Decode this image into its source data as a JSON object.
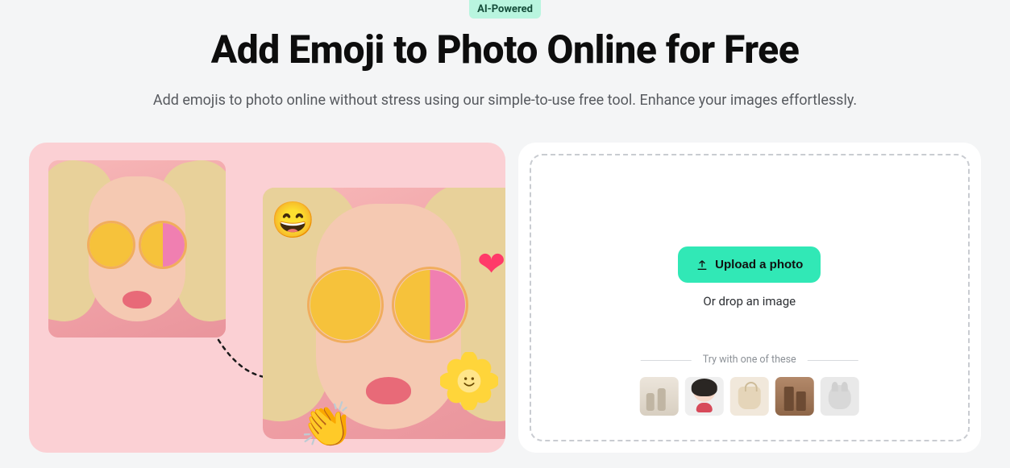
{
  "badge": "AI-Powered",
  "title": "Add Emoji to Photo Online for Free",
  "subtitle": "Add emojis to photo online without stress using our simple-to-use free tool. Enhance your images effortlessly.",
  "upload": {
    "button": "Upload a photo",
    "drop_text": "Or drop an image"
  },
  "samples": {
    "label": "Try with one of these",
    "items": [
      "cosmetics",
      "woman-portrait",
      "handbag",
      "coffee-cups",
      "cat"
    ]
  },
  "emoji_stickers": {
    "laugh": "😄",
    "heart": "❤",
    "clap": "👏"
  }
}
